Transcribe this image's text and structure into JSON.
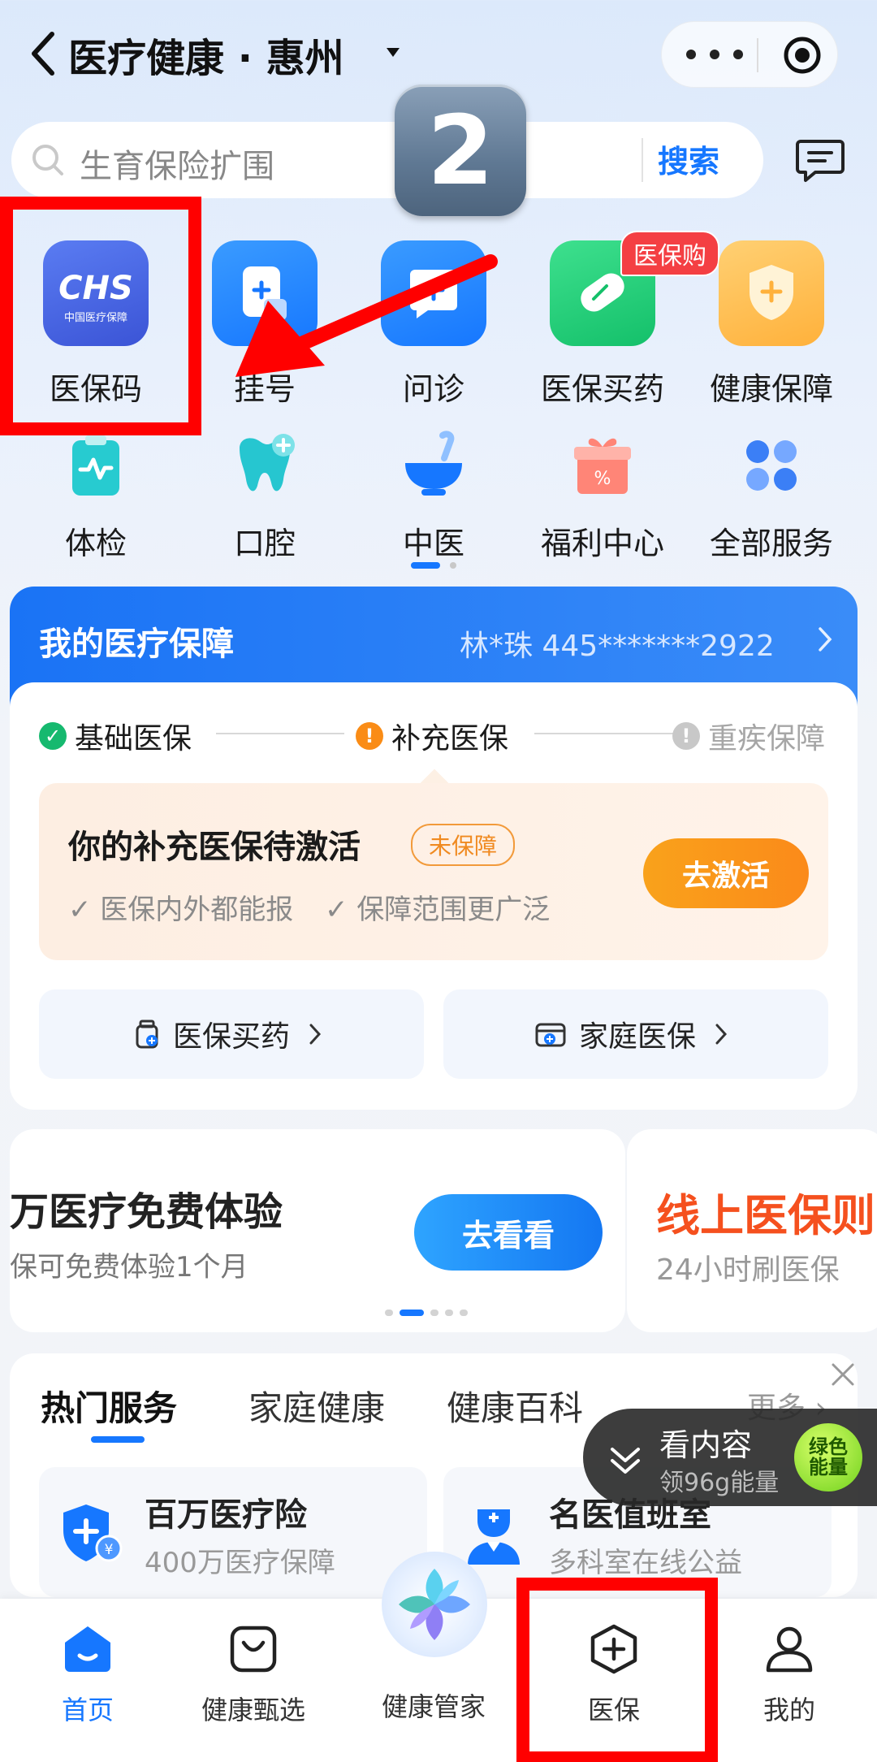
{
  "header": {
    "title": "医疗健康 · 惠州"
  },
  "search": {
    "placeholder": "生育保险扩围",
    "button": "搜索"
  },
  "overlay": {
    "step_number": "2"
  },
  "services_row1": [
    {
      "label": "医保码",
      "icon": "chs-icon",
      "sublabel": "CHS",
      "subcaption": "中国医疗保障"
    },
    {
      "label": "挂号",
      "icon": "register-icon"
    },
    {
      "label": "问诊",
      "icon": "consult-icon"
    },
    {
      "label": "医保买药",
      "icon": "pill-icon",
      "badge": "医保购"
    },
    {
      "label": "健康保障",
      "icon": "shield-icon"
    }
  ],
  "services_row2": [
    {
      "label": "体检",
      "icon": "checkup-icon"
    },
    {
      "label": "口腔",
      "icon": "tooth-icon"
    },
    {
      "label": "中医",
      "icon": "tcm-bowl-icon"
    },
    {
      "label": "福利中心",
      "icon": "gift-icon"
    },
    {
      "label": "全部服务",
      "icon": "grid-icon"
    }
  ],
  "insurance": {
    "title": "我的医疗保障",
    "user": "林*珠 445*******2922",
    "steps": [
      "基础医保",
      "补充医保",
      "重疾保障"
    ],
    "activate_title": "你的补充医保待激活",
    "activate_tag": "未保障",
    "benefits": [
      "医保内外都能报",
      "保障范围更广泛"
    ],
    "activate_button": "去激活",
    "links": [
      "医保买药",
      "家庭医保"
    ]
  },
  "banner": {
    "title": "万医疗免费体验",
    "subtitle": "保可免费体验1个月",
    "button": "去看看",
    "next_title": "线上医保则",
    "next_subtitle": "24小时刷医保"
  },
  "hot": {
    "tabs": [
      "热门服务",
      "家庭健康",
      "健康百科"
    ],
    "more": "更多",
    "items": [
      {
        "name": "百万医疗险",
        "desc": "400万医疗保障",
        "icon": "medical-shield-icon"
      },
      {
        "name": "名医值班室",
        "desc": "多科室在线公益",
        "icon": "doctor-icon"
      }
    ]
  },
  "floating": {
    "title": "看内容",
    "subtitle": "领96g能量",
    "energy_line1": "绿色",
    "energy_line2": "能量"
  },
  "nav": [
    {
      "label": "首页",
      "icon": "home-icon",
      "active": true
    },
    {
      "label": "健康甄选",
      "icon": "bag-icon"
    },
    {
      "label": "健康管家",
      "icon": "ai-assistant-icon"
    },
    {
      "label": "医保",
      "icon": "medical-insurance-icon"
    },
    {
      "label": "我的",
      "icon": "profile-icon"
    }
  ],
  "colors": {
    "primary": "#1677ff",
    "orange": "#fb8a1a",
    "annotation_red": "#ff0000"
  }
}
